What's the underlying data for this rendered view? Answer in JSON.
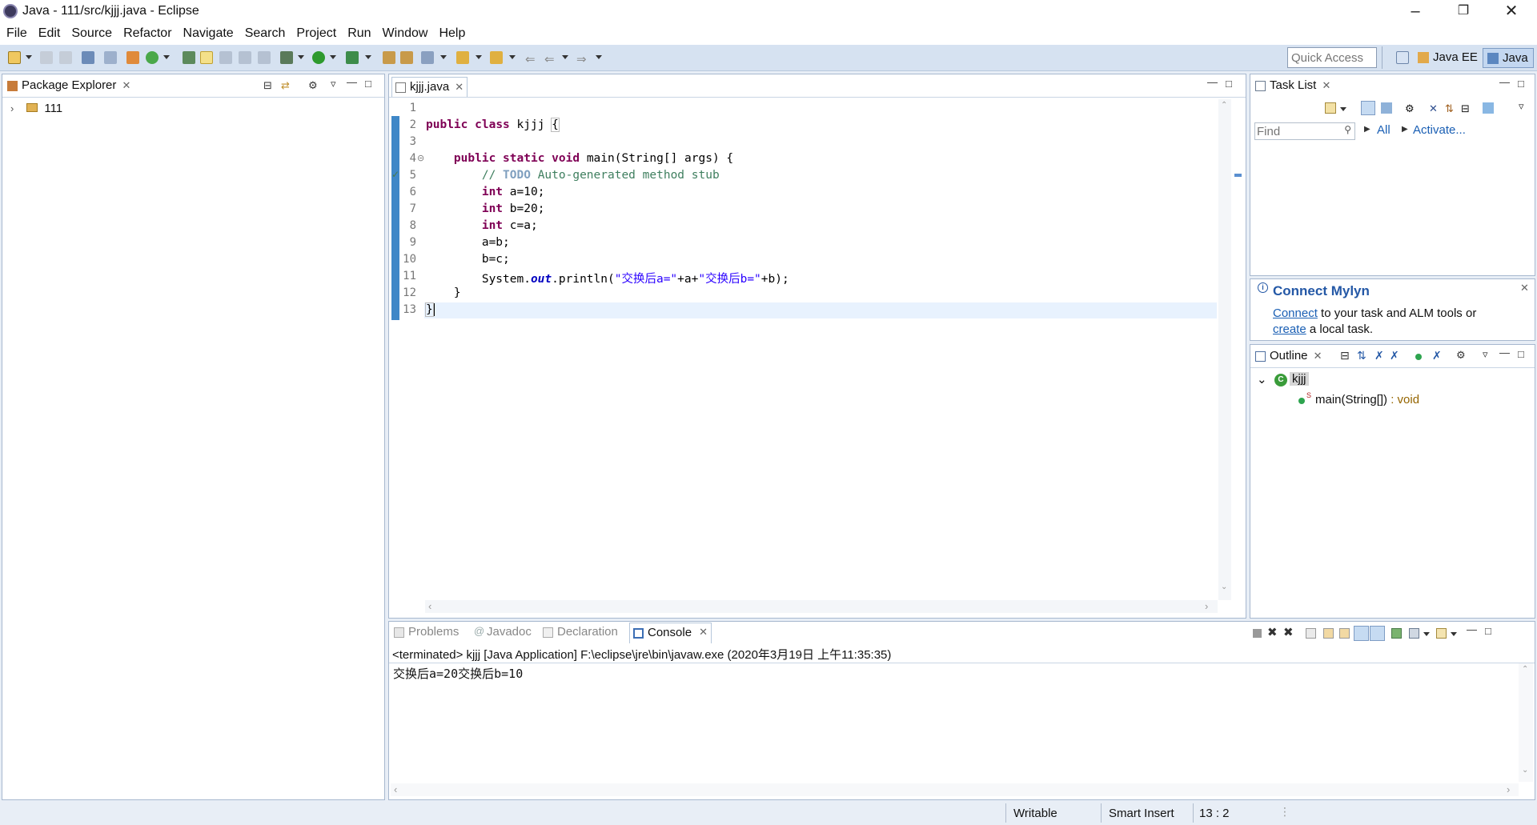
{
  "window": {
    "title": "Java - 111/src/kjjj.java - Eclipse"
  },
  "menu": [
    "File",
    "Edit",
    "Source",
    "Refactor",
    "Navigate",
    "Search",
    "Project",
    "Run",
    "Window",
    "Help"
  ],
  "toolbar": {
    "quick_access_placeholder": "Quick Access",
    "perspectives": [
      "Java EE",
      "Java"
    ]
  },
  "package_explorer": {
    "tab_label": "Package Explorer",
    "tree": [
      {
        "label": "111",
        "expanded": false
      }
    ]
  },
  "editor": {
    "tab_label": "kjjj.java",
    "line_numbers": [
      "1",
      "2",
      "3",
      "4",
      "5",
      "6",
      "7",
      "8",
      "9",
      "10",
      "11",
      "12",
      "13"
    ],
    "cursor_line": 13
  },
  "task_list": {
    "tab_label": "Task List",
    "find_placeholder": "Find",
    "filter_all": "All",
    "activate": "Activate..."
  },
  "mylyn": {
    "title": "Connect Mylyn",
    "connect_link": "Connect",
    "text_1": "to your task and ALM tools or",
    "create_link": "create",
    "text_2": "a local task."
  },
  "outline": {
    "tab_label": "Outline",
    "class_name": "kjjj",
    "method": "main(String[])",
    "return_type": " : void"
  },
  "bottom_tabs": [
    "Problems",
    "Javadoc",
    "Declaration",
    "Console"
  ],
  "console": {
    "header": "<terminated> kjjj [Java Application] F:\\eclipse\\jre\\bin\\javaw.exe (2020年3月19日 上午11:35:35)",
    "output": "交换后a=20交换后b=10"
  },
  "status": {
    "writable": "Writable",
    "insert_mode": "Smart Insert",
    "position": "13 : 2"
  },
  "colors": {
    "keyword": "#7f0055",
    "comment": "#3f7f5f",
    "string": "#2a00ff",
    "link": "#1a5fb4",
    "mylyn_title": "#2458a6"
  }
}
